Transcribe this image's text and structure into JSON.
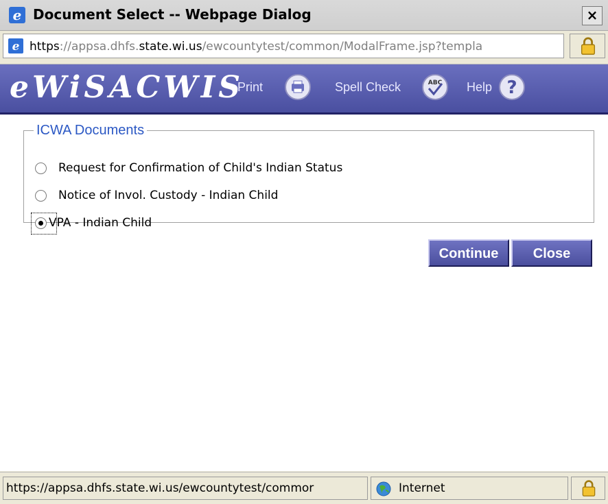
{
  "window": {
    "title": "Document Select -- Webpage Dialog",
    "close_symbol": "×",
    "icon": "ie-icon"
  },
  "address": {
    "url_parts": [
      "https",
      "://appsa.dhfs.",
      "state.wi.us",
      "/ewcountytest/common/ModalFrame.jsp?templa"
    ],
    "icon": "page-icon",
    "lock_icon": "padlock-icon"
  },
  "header": {
    "logo": "eWiSACWIS",
    "print_label": "Print",
    "spell_check_label": "Spell Check",
    "help_label": "Help",
    "bg_color": "#5a5fb0"
  },
  "group": {
    "legend": "ICWA Documents",
    "options": [
      {
        "label": "Request for Confirmation of Child's Indian Status",
        "checked": false
      },
      {
        "label": "Notice of Invol. Custody - Indian Child",
        "checked": false
      },
      {
        "label": "VPA - Indian Child",
        "checked": true
      }
    ]
  },
  "buttons": {
    "continue_label": "Continue",
    "close_label": "Close"
  },
  "status": {
    "url": "https://appsa.dhfs.state.wi.us/ewcountytest/commor",
    "zone": "Internet"
  },
  "colors": {
    "legend": "#2b58c4",
    "button": "#4b4f9e"
  }
}
